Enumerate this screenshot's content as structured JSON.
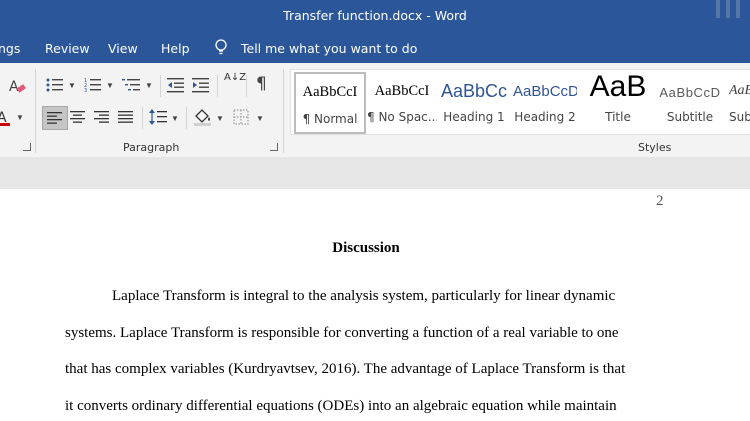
{
  "window": {
    "title": "Transfer function.docx  -  Word"
  },
  "menu": {
    "items": [
      "ngs",
      "Review",
      "View",
      "Help"
    ],
    "tell_me": "Tell me what you want to do"
  },
  "ribbon": {
    "paragraph_label": "Paragraph",
    "styles_label": "Styles",
    "styles": [
      {
        "preview": "AaBbCcI",
        "name": "¶ Normal"
      },
      {
        "preview": "AaBbCcI",
        "name": "¶ No Spac..."
      },
      {
        "preview": "AaBbCc",
        "name": "Heading 1"
      },
      {
        "preview": "AaBbCcD",
        "name": "Heading 2"
      },
      {
        "preview": "AaB",
        "name": "Title"
      },
      {
        "preview": "AaBbCcD",
        "name": "Subtitle"
      },
      {
        "preview": "AaB",
        "name": "Sub"
      }
    ],
    "sort_label": "A↓Z",
    "pilcrow": "¶"
  },
  "document": {
    "page_number": "2",
    "heading": "Discussion",
    "lines": [
      "Laplace Transform is integral to the analysis system, particularly for linear dynamic",
      "systems. Laplace Transform is responsible for converting a function of a real variable to one",
      "that has complex variables (Kurdryavtsev, 2016). The advantage of Laplace Transform is that",
      "it converts ordinary differential equations (ODEs) into an algebraic equation while maintain"
    ]
  }
}
